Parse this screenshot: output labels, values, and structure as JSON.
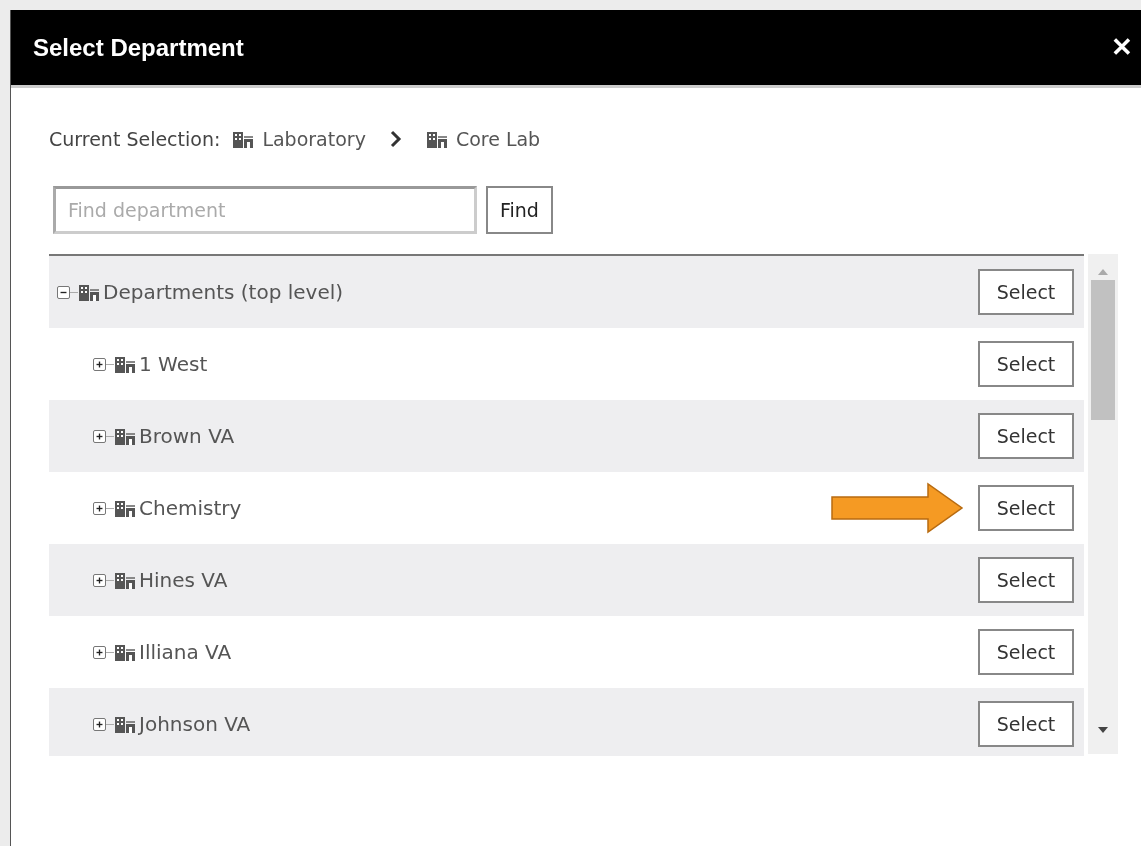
{
  "dialog": {
    "title": "Select Department",
    "close": "✕"
  },
  "current_selection": {
    "label": "Current Selection:",
    "path": [
      "Laboratory",
      "Core Lab"
    ]
  },
  "search": {
    "placeholder": "Find department",
    "button": "Find"
  },
  "tree": [
    {
      "label": "Departments (top level)",
      "expanded": true,
      "action": "Select",
      "pointer": false,
      "children": [
        {
          "label": "1 West",
          "expanded": false,
          "action": "Select",
          "pointer": false
        },
        {
          "label": "Brown VA",
          "expanded": false,
          "action": "Select",
          "pointer": false
        },
        {
          "label": "Chemistry",
          "expanded": false,
          "action": "Select",
          "pointer": true
        },
        {
          "label": "Hines VA",
          "expanded": false,
          "action": "Select",
          "pointer": false
        },
        {
          "label": "Illiana VA",
          "expanded": false,
          "action": "Select",
          "pointer": false
        },
        {
          "label": "Johnson VA",
          "expanded": false,
          "action": "Select",
          "pointer": false
        }
      ]
    }
  ]
}
